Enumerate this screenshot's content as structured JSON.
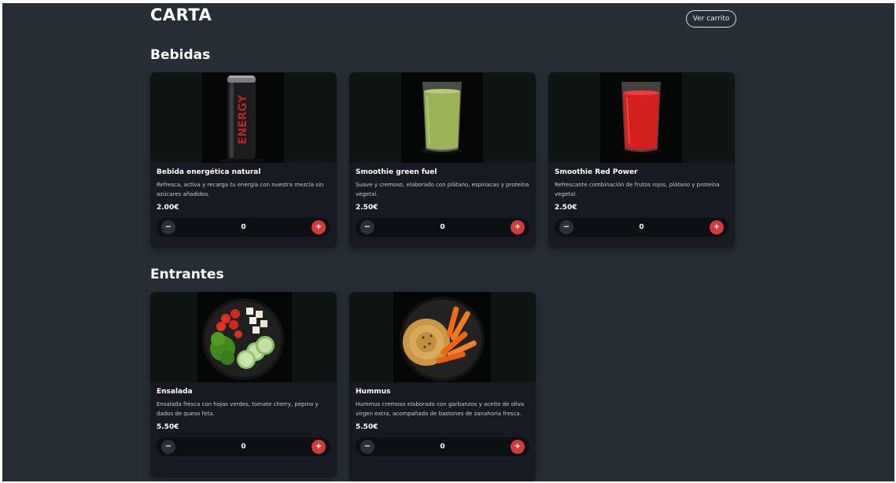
{
  "header": {
    "title": "CARTA",
    "cart_button": "Ver carrito"
  },
  "sections": [
    {
      "title": "Bebidas",
      "items": [
        {
          "name": "Bebida energética natural",
          "description": "Refresca, activa y recarga tu energía con nuestra mezcla sin azúcares añadidos.",
          "price": "2.00€",
          "quantity": "0",
          "minus": "−",
          "plus": "+",
          "image_icon": "energy-can-image",
          "can_label": "ENERGY"
        },
        {
          "name": "Smoothie green fuel",
          "description": "Suave y cremoso, elaborado con plátano, espinacas y proteína vegetal.",
          "price": "2.50€",
          "quantity": "0",
          "minus": "−",
          "plus": "+",
          "image_icon": "green-smoothie-image"
        },
        {
          "name": "Smoothie Red Power",
          "description": "Refrescante combinación de frutos rojos, plátano y proteína vegetal.",
          "price": "2.50€",
          "quantity": "0",
          "minus": "−",
          "plus": "+",
          "image_icon": "red-smoothie-image"
        }
      ]
    },
    {
      "title": "Entrantes",
      "items": [
        {
          "name": "Ensalada",
          "description": "Ensalada fresca con hojas verdes, tomate cherry, pepino y dados de queso feta.",
          "price": "5.50€",
          "quantity": "0",
          "minus": "−",
          "plus": "+",
          "image_icon": "salad-bowl-image"
        },
        {
          "name": "Hummus",
          "description": "Hummus cremoso elaborado con garbanzos y aceite de oliva virgen extra, acompañado de bastones de zanahoria fresca.",
          "price": "5.50€",
          "quantity": "0",
          "minus": "−",
          "plus": "+",
          "image_icon": "hummus-bowl-image"
        }
      ]
    }
  ],
  "colors": {
    "background": "#262d35",
    "card": "#171a23",
    "accent": "#d23b3b"
  }
}
